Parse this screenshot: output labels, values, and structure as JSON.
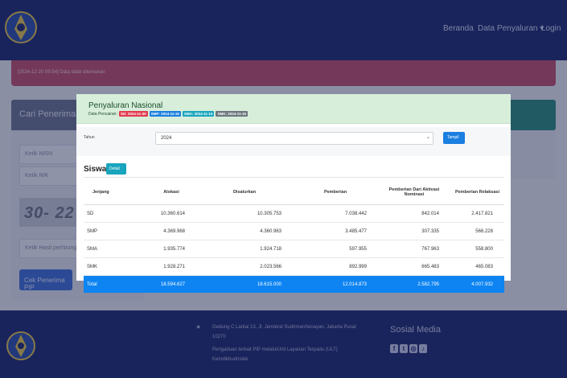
{
  "navbar": {
    "links": [
      "Beranda",
      "Data Penyaluran ▾",
      "Login"
    ]
  },
  "alert": {
    "text": "[2024-12-20 09:54] Data tidak ditemukan"
  },
  "search_card": {
    "title": "Cari Penerima PIP",
    "nisn_placeholder": "Ketik NISN",
    "nik_placeholder": "Ketik NIK",
    "captcha_text": "30- 22",
    "captcha_placeholder": "Ketik Hasil perhitungan",
    "button_label": "Cek Penerima PIP"
  },
  "modal": {
    "title": "Penyaluran Nasional",
    "subtitle": "Data Pencairan:",
    "badges": [
      {
        "label": "SD: 2024-11-30",
        "color": "#e2394d"
      },
      {
        "label": "SMP: 2024-11-15",
        "color": "#1a7fe0"
      },
      {
        "label": "SMA: 2024-11-15",
        "color": "#18a5bd"
      },
      {
        "label": "SMK: 2024-11-15",
        "color": "#6c757d"
      }
    ],
    "filter": {
      "label": "Tahun",
      "selected": "2024",
      "button_label": "Tampil"
    },
    "section": {
      "title": "Siswa",
      "detail_button": "Detail"
    },
    "table": {
      "headers": [
        "Jenjang",
        "Alokasi",
        "Disalurkan",
        "Pemberian",
        "Pemberian Dari Aktivasi Nominasi",
        "Pemberian Relaksasi"
      ],
      "rows": [
        [
          "SD",
          "10.360.614",
          "10.305.753",
          "7.038.442",
          "842.014",
          "2.417.821"
        ],
        [
          "SMP",
          "4.369.968",
          "4.360.963",
          "3.485.477",
          "307.335",
          "566.228"
        ],
        [
          "SMA",
          "1.935.774",
          "1.924.718",
          "597.955",
          "767.963",
          "558.800"
        ],
        [
          "SMK",
          "1.928.271",
          "2.023.566",
          "892.999",
          "665.483",
          "465.083"
        ]
      ],
      "total": [
        "Total",
        "18.594.627",
        "18.615.000",
        "12.014.873",
        "2.582.795",
        "4.007.932"
      ]
    }
  },
  "footer": {
    "address_line1": "Gedung C Lantai 13, Jl. Jenderal SudirmanSenayan, Jakarta Pusat",
    "address_line2": "10270",
    "complaint_line1": "Pengaduan terkait PIP melaluiUnit Layanan Terpadu (ULT)",
    "complaint_line2": "Kemdikbudristek",
    "social_title": "Sosial Media",
    "social_icons": [
      "facebook-icon",
      "twitter-icon",
      "instagram-icon",
      "tiktok-icon"
    ]
  }
}
